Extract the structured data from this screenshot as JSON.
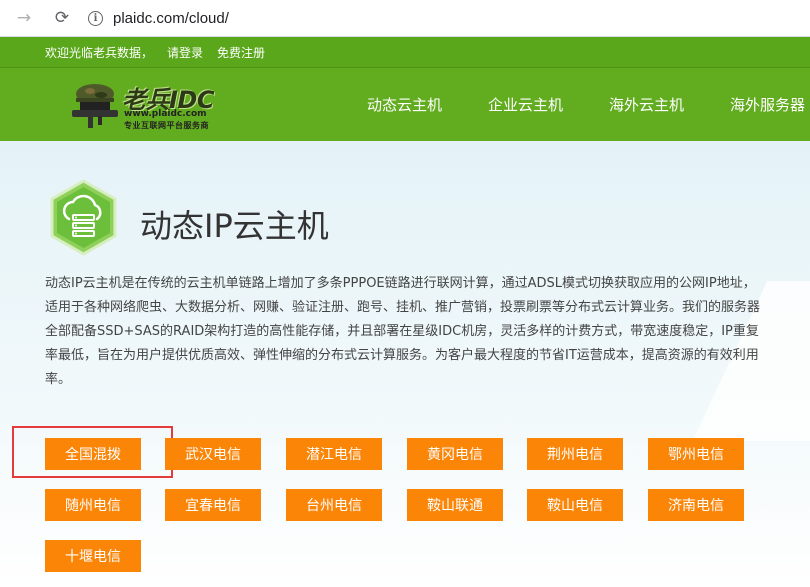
{
  "browser": {
    "back_icon": "→",
    "reload_icon": "⟳",
    "info_icon": "i",
    "url": "plaidc.com/cloud/"
  },
  "topstrip": {
    "welcome": "欢迎光临老兵数据，",
    "login": "请登录",
    "register": "免费注册"
  },
  "logo": {
    "title": "老兵IDC",
    "url": "www.plaidc.com",
    "slogan": "专业互联网平台服务商"
  },
  "nav": [
    {
      "label": "动态云主机"
    },
    {
      "label": "企业云主机"
    },
    {
      "label": "海外云主机"
    },
    {
      "label": "海外服务器"
    }
  ],
  "hero": {
    "title": "动态IP云主机",
    "icon": "cloud-server-icon",
    "description": "动态IP云主机是在传统的云主机单链路上增加了多条PPPOE链路进行联网计算，通过ADSL模式切换获取应用的公网IP地址，适用于各种网络爬虫、大数据分析、网赚、验证注册、跑号、挂机、推广营销，投票刷票等分布式云计算业务。我们的服务器全部配备SSD+SAS的RAID架构打造的高性能存储，并且部署在星级IDC机房，灵活多样的计费方式，带宽速度稳定，IP重复率最低，旨在为用户提供优质高效、弹性伸缩的分布式云计算服务。为客户最大程度的节省IT运营成本，提高资源的有效利用率。"
  },
  "locations": [
    {
      "label": "全国混拨"
    },
    {
      "label": "武汉电信"
    },
    {
      "label": "潜江电信"
    },
    {
      "label": "黄冈电信"
    },
    {
      "label": "荆州电信"
    },
    {
      "label": "鄂州电信"
    },
    {
      "label": "随州电信"
    },
    {
      "label": "宜春电信"
    },
    {
      "label": "台州电信"
    },
    {
      "label": "鞍山联通"
    },
    {
      "label": "鞍山电信"
    },
    {
      "label": "济南电信"
    },
    {
      "label": "十堰电信"
    }
  ],
  "colors": {
    "brand_green": "#62ac1f",
    "button_orange": "#fb8507",
    "highlight_red": "#e43c3c"
  }
}
